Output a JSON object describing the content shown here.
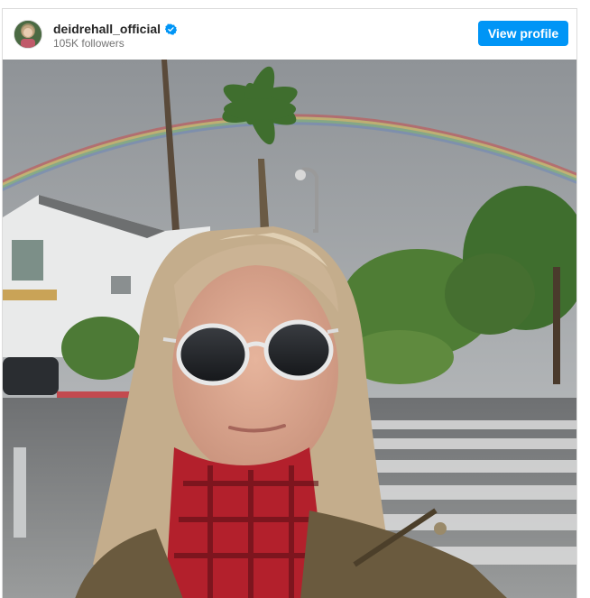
{
  "profile": {
    "username": "deidrehall_official",
    "followers": "105K followers",
    "view_profile_label": "View profile",
    "verified_color": "#0095f6"
  },
  "post": {
    "image_icon": "selfie-photo"
  },
  "colors": {
    "button": "#0095f6"
  }
}
